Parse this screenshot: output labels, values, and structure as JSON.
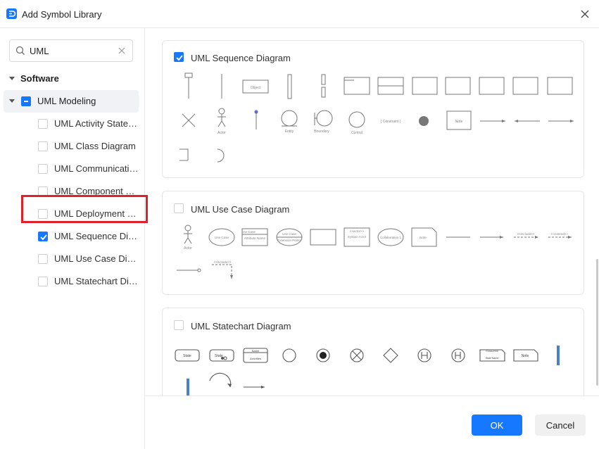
{
  "window": {
    "title": "Add Symbol Library"
  },
  "search": {
    "value": "UML"
  },
  "tree": {
    "root": "Software",
    "group": "UML Modeling",
    "children": [
      {
        "label": "UML Activity State Diagram",
        "checked": false
      },
      {
        "label": "UML Class Diagram",
        "checked": false
      },
      {
        "label": "UML Communication Diagram",
        "checked": false
      },
      {
        "label": "UML Component Diagram",
        "checked": false
      },
      {
        "label": "UML Deployment Diagram",
        "checked": false
      },
      {
        "label": "UML Sequence Diagram",
        "checked": true
      },
      {
        "label": "UML Use Case Diagram",
        "checked": false
      },
      {
        "label": "UML Statechart Diagram",
        "checked": false
      }
    ]
  },
  "sections": {
    "sequence": {
      "title": "UML Sequence Diagram",
      "checked": true,
      "labels": {
        "object": "Object",
        "actor": "Actor",
        "entity": "Entity",
        "boundary": "Boundary",
        "control": "Control",
        "constraint": "{ Constraint }",
        "note": "Note"
      }
    },
    "usecase": {
      "title": "UML Use Case Diagram",
      "checked": false,
      "labels": {
        "actor": "Actor",
        "use_case": "Use Case",
        "use_case_box": "Use Case",
        "attribute": "Attribute Name",
        "use_case2": "Use Case",
        "extension": "Extension Points",
        "system_actor": "System Actor",
        "actor_stereotype": "<<actor>>",
        "collaboration": "Collaboration 1",
        "note": "Note",
        "include": "<<include>>",
        "extend": "<<extend>>",
        "include2": "<<include>>"
      }
    },
    "statechart": {
      "title": "UML Statechart Diagram",
      "checked": false,
      "labels": {
        "state": "State",
        "state2": "State",
        "name": "Name",
        "activities": "Activities",
        "concurrent": "Concurrent",
        "state_name": "State Name",
        "note": "Note"
      }
    }
  },
  "footer": {
    "ok": "OK",
    "cancel": "Cancel"
  },
  "colors": {
    "accent": "#1677ff",
    "highlight": "#e0202a"
  }
}
